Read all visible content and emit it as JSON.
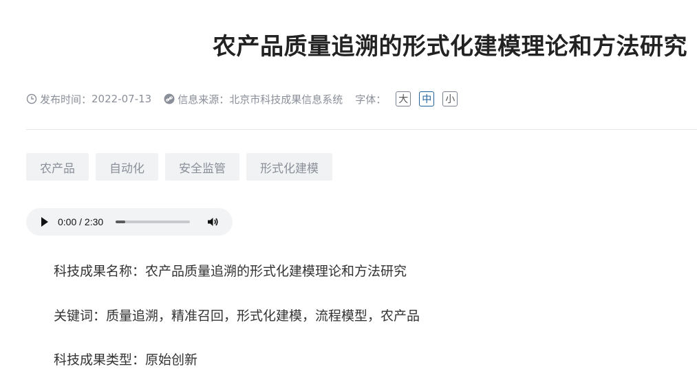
{
  "article": {
    "title": "农产品质量追溯的形式化建模理论和方法研究"
  },
  "meta": {
    "publish_label": "发布时间：",
    "publish_date": "2022-07-13",
    "source_label": "信息来源：",
    "source": "北京市科技成果信息系统",
    "font_label": "字体：",
    "font_sizes": [
      "大",
      "中",
      "小"
    ],
    "font_size_selected": "中",
    "icons": {
      "date": "clock-icon",
      "source": "link-icon"
    }
  },
  "tags": [
    "农产品",
    "自动化",
    "安全监管",
    "形式化建模"
  ],
  "audio": {
    "time": "0:00 / 2:30",
    "progress": 0.0
  },
  "content": [
    "科技成果名称：农产品质量追溯的形式化建模理论和方法研究",
    "关键词：质量追溯，精准召回，形式化建模，流程模型，农产品",
    "科技成果类型：原始创新"
  ]
}
